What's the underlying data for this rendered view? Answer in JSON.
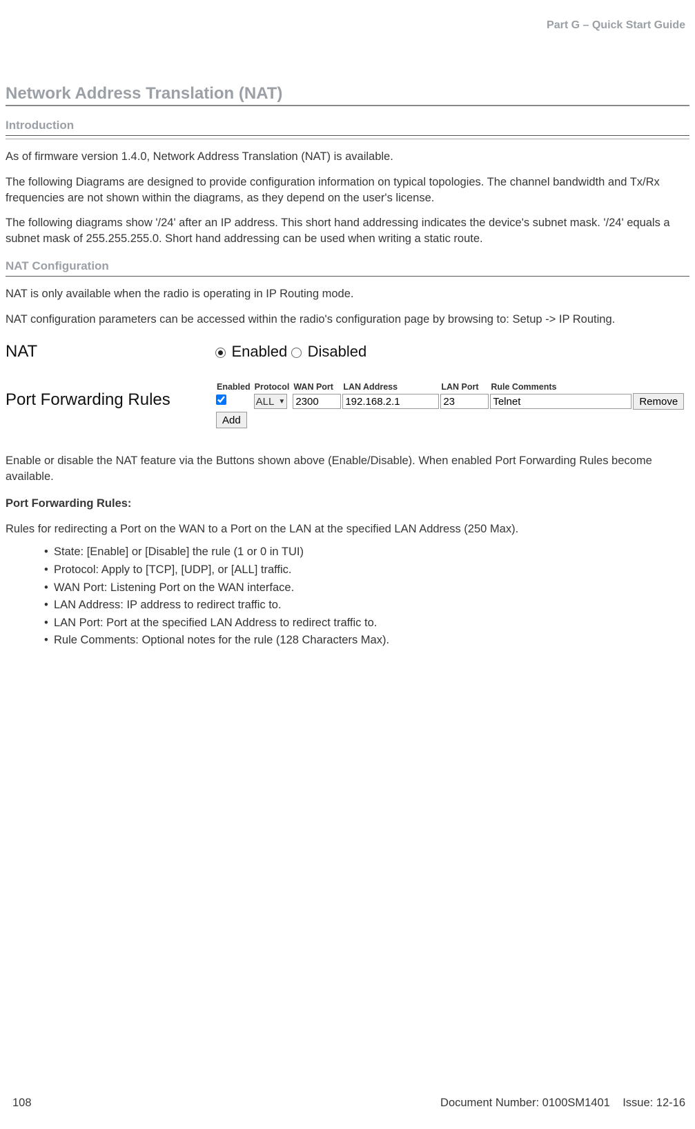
{
  "header": {
    "part_title": "Part G – Quick Start Guide"
  },
  "section": {
    "title": "Network Address Translation (NAT)",
    "intro_heading": "Introduction",
    "nat_config_heading": "NAT Configuration",
    "p1": "As of firmware version 1.4.0, Network Address Translation (NAT) is available.",
    "p2": "The following Diagrams are designed to provide configuration information on typical topologies. The channel bandwidth and Tx/Rx frequencies are not shown within the diagrams, as they depend on the user's license.",
    "p3": "The following diagrams show '/24' after an IP address. This short hand addressing indicates the device's subnet mask. '/24' equals a subnet mask of 255.255.255.0. Short hand addressing can be used when writing a static route.",
    "p4": "NAT is only available when the radio is operating in IP Routing mode.",
    "p5": "NAT configuration parameters can be accessed within the radio's configuration page by browsing to: Setup -> IP Routing.",
    "p6": "Enable or disable the NAT feature via the Buttons shown above (Enable/Disable). When enabled Port Forwarding Rules become available.",
    "pfr_heading": "Port Forwarding Rules:",
    "p7": "Rules for redirecting a Port on the WAN to a Port on the LAN at the specified LAN Address (250 Max)."
  },
  "nat_widget": {
    "label": "NAT",
    "enabled_label": "Enabled",
    "disabled_label": "Disabled",
    "selected": "enabled"
  },
  "pf_widget": {
    "label": "Port Forwarding Rules",
    "headers": {
      "enabled": "Enabled",
      "protocol": "Protocol",
      "wan_port": "WAN Port",
      "lan_address": "LAN Address",
      "lan_port": "LAN Port",
      "rule_comments": "Rule Comments"
    },
    "row": {
      "enabled": true,
      "protocol": "ALL",
      "wan_port": "2300",
      "lan_address": "192.168.2.1",
      "lan_port": "23",
      "rule_comments": "Telnet"
    },
    "remove_label": "Remove",
    "add_label": "Add"
  },
  "bullets": {
    "b1": "State: [Enable] or [Disable] the rule (1 or 0 in TUI)",
    "b2": "Protocol: Apply to [TCP], [UDP], or [ALL] traffic.",
    "b3": "WAN Port: Listening Port on the WAN interface.",
    "b4": "LAN Address: IP address to redirect traffic to.",
    "b5": "LAN Port: Port at the specified LAN Address to redirect traffic to.",
    "b6": "Rule Comments: Optional notes for the rule (128 Characters Max)."
  },
  "footer": {
    "page_num": "108",
    "doc_num": "Document Number: 0100SM1401",
    "issue": "Issue: 12-16"
  }
}
